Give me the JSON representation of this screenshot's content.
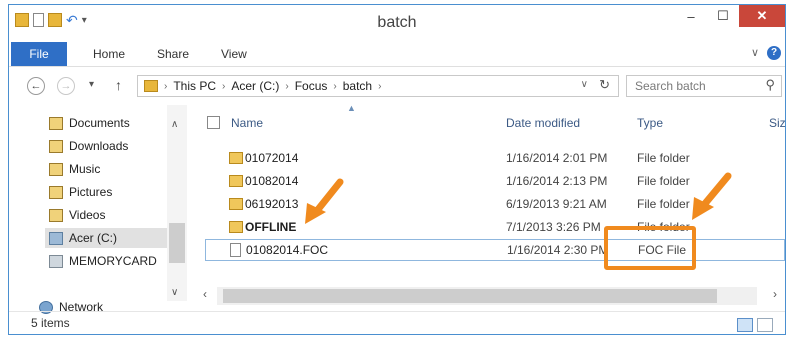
{
  "window": {
    "title": "batch",
    "controls": {
      "minimize": "–",
      "maximize": "☐",
      "close": "✕"
    }
  },
  "ribbon": {
    "tabs": [
      "File",
      "Home",
      "Share",
      "View"
    ],
    "help": "?",
    "expand": "∨"
  },
  "address": {
    "back": "←",
    "forward": "→",
    "recent": "▾",
    "up": "↑",
    "crumbs": [
      "This PC",
      "Acer (C:)",
      "Focus",
      "batch"
    ],
    "separator": "›",
    "dropdown": "∨",
    "refresh": "↻",
    "search_placeholder": "Search batch",
    "search_icon": "search-icon"
  },
  "nav": {
    "items": [
      {
        "label": "Documents",
        "icon": "documents-icon"
      },
      {
        "label": "Downloads",
        "icon": "downloads-icon"
      },
      {
        "label": "Music",
        "icon": "music-icon"
      },
      {
        "label": "Pictures",
        "icon": "pictures-icon"
      },
      {
        "label": "Videos",
        "icon": "videos-icon"
      },
      {
        "label": "Acer (C:)",
        "icon": "drive-icon",
        "selected": true
      },
      {
        "label": "MEMORYCARD",
        "icon": "memory-card-icon"
      },
      {
        "label": "Network",
        "icon": "network-icon"
      }
    ],
    "scroll_up": "∧",
    "scroll_down": "∨"
  },
  "columns": {
    "name": "Name",
    "date": "Date modified",
    "type": "Type",
    "size": "Size",
    "sort_indicator": "▲"
  },
  "files": [
    {
      "name": "01072014",
      "date": "1/16/2014 2:01 PM",
      "type": "File folder",
      "icon": "folder-icon"
    },
    {
      "name": "01082014",
      "date": "1/16/2014 2:13 PM",
      "type": "File folder",
      "icon": "folder-icon"
    },
    {
      "name": "06192013",
      "date": "6/19/2013 9:21 AM",
      "type": "File folder",
      "icon": "folder-icon"
    },
    {
      "name": "OFFLINE",
      "date": "7/1/2013 3:26 PM",
      "type": "File folder",
      "icon": "folder-icon"
    },
    {
      "name": "01082014.FOC",
      "date": "1/16/2014 2:30 PM",
      "type": "FOC File",
      "icon": "file-icon"
    }
  ],
  "hscroll": {
    "left": "‹",
    "right": "›"
  },
  "status": {
    "count": "5 items"
  },
  "colors": {
    "accent": "#2f6fc6",
    "callout": "#f08a1e",
    "close": "#c9473a"
  }
}
